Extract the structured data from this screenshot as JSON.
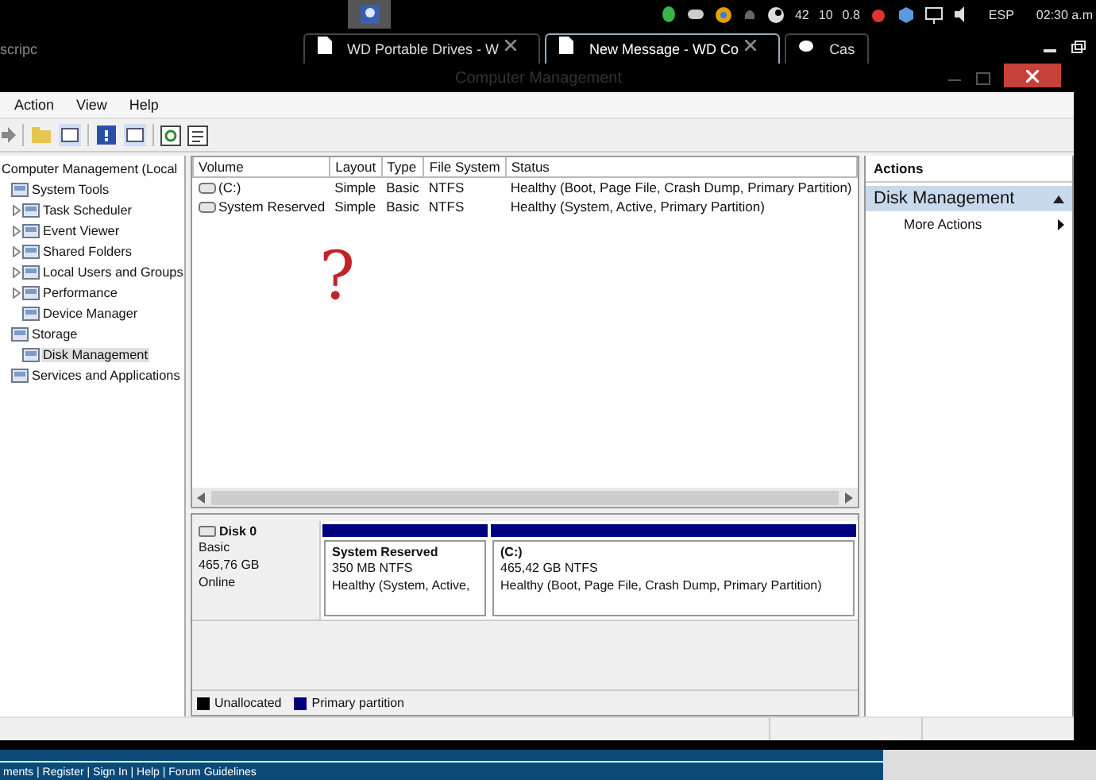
{
  "taskbar": {
    "tray": [
      "42",
      "10",
      "0.8"
    ],
    "language": "ESP",
    "clock": "02:30 a.m"
  },
  "browser_tabs": [
    {
      "label": "scripc",
      "selected": false
    },
    {
      "label": "WD Portable Drives - W",
      "selected": false
    },
    {
      "label": "New Message - WD Co",
      "selected": true
    },
    {
      "label": "Cas",
      "selected": false
    }
  ],
  "window": {
    "title": "Computer Management"
  },
  "menu": [
    "Action",
    "View",
    "Help"
  ],
  "tree": [
    {
      "label": "Computer Management (Local",
      "selected": false,
      "children": [
        {
          "label": "System Tools",
          "selected": false,
          "children": [
            {
              "label": "Task Scheduler",
              "selected": false,
              "expanded": false
            },
            {
              "label": "Event Viewer",
              "selected": false,
              "expanded": false
            },
            {
              "label": "Shared Folders",
              "selected": false,
              "expanded": false
            },
            {
              "label": "Local Users and Groups",
              "selected": false,
              "expanded": false
            },
            {
              "label": "Performance",
              "selected": false,
              "expanded": false
            },
            {
              "label": "Device Manager",
              "selected": false
            }
          ]
        },
        {
          "label": "Storage",
          "selected": false,
          "children": [
            {
              "label": "Disk Management",
              "selected": true
            }
          ]
        },
        {
          "label": "Services and Applications",
          "selected": false
        }
      ]
    }
  ],
  "volumes": {
    "columns": [
      "Volume",
      "Layout",
      "Type",
      "File System",
      "Status"
    ],
    "rows": [
      [
        "(C:)",
        "Simple",
        "Basic",
        "NTFS",
        "Healthy (Boot, Page File, Crash Dump, Primary Partition)"
      ],
      [
        "System Reserved",
        "Simple",
        "Basic",
        "NTFS",
        "Healthy (System, Active, Primary Partition)"
      ]
    ]
  },
  "annotation": "?",
  "disk": {
    "name": "Disk 0",
    "lines": [
      "Basic",
      "465,76 GB",
      "Online"
    ],
    "partitions": [
      {
        "name": "System Reserved",
        "size": "350 MB NTFS",
        "status": "Healthy (System, Active,"
      },
      {
        "name": "(C:)",
        "size": "465,42 GB NTFS",
        "status": "Healthy (Boot, Page File, Crash Dump, Primary Partition)"
      }
    ]
  },
  "legend": [
    {
      "label": "Unallocated",
      "color": "#000000"
    },
    {
      "label": "Primary partition",
      "color": "#00007f"
    }
  ],
  "actions": {
    "title": "Actions",
    "sections": [
      {
        "label": "Disk Management",
        "selected": true,
        "items": [
          "More Actions"
        ]
      }
    ]
  },
  "forum_links": "ments | Register | Sign In | Help | Forum Guidelines"
}
